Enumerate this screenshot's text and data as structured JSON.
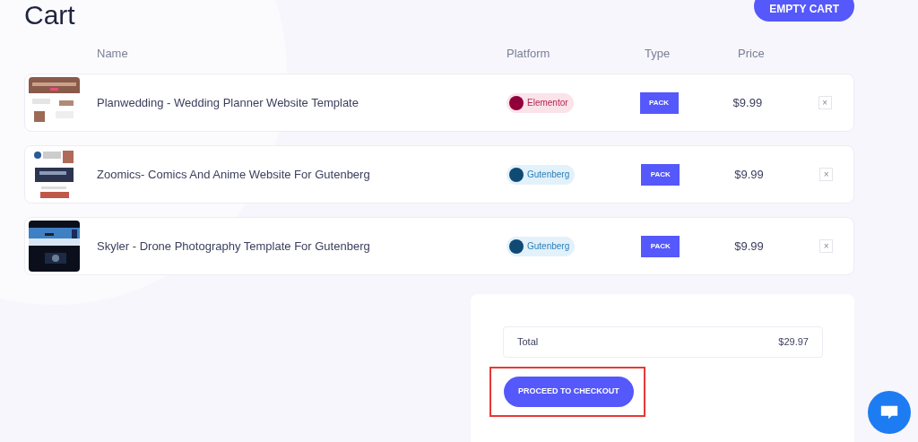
{
  "title": "Cart",
  "empty_button": "EMPTY CART",
  "columns": [
    "Name",
    "Platform",
    "Type",
    "Price"
  ],
  "items": [
    {
      "name": "Planwedding - Wedding Planner Website Template",
      "platform": {
        "label": "Elementor",
        "kind": "elementor"
      },
      "type": "PACK",
      "price": "$9.99",
      "remove": "×"
    },
    {
      "name": "Zoomics- Comics And Anime Website For Gutenberg",
      "platform": {
        "label": "Gutenberg",
        "kind": "gutenberg"
      },
      "type": "PACK",
      "price": "$9.99",
      "remove": "×"
    },
    {
      "name": "Skyler - Drone Photography Template For Gutenberg",
      "platform": {
        "label": "Gutenberg",
        "kind": "gutenberg"
      },
      "type": "PACK",
      "price": "$9.99",
      "remove": "×"
    }
  ],
  "summary": {
    "total_label": "Total",
    "total_value": "$29.97",
    "checkout_button": "PROCEED TO CHECKOUT",
    "checkout_highlighted": true
  }
}
